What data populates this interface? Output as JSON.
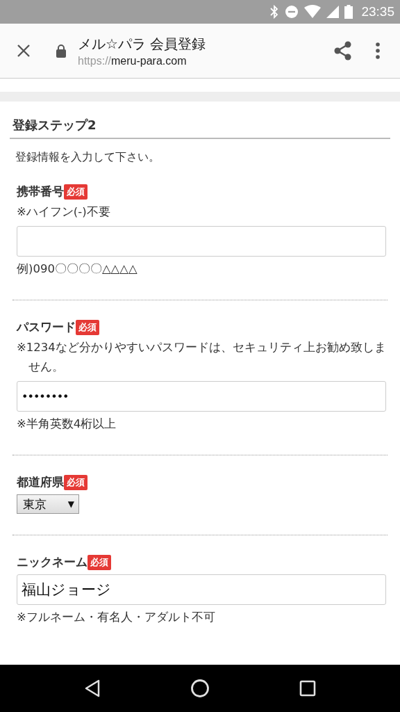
{
  "status_bar": {
    "time": "23:35"
  },
  "toolbar": {
    "title": "メル☆パラ 会員登録",
    "url_scheme": "https://",
    "url_host": "meru-para.com"
  },
  "heading": "登録ステップ2",
  "intro": "登録情報を入力して下さい。",
  "sections": [
    {
      "kind": "text",
      "label": "携帯番号",
      "badge": "必須",
      "notes_above": [
        "※ハイフン(-)不要"
      ],
      "notes_below": [
        "例)090〇〇〇〇△△△△"
      ]
    },
    {
      "kind": "password",
      "label": "パスワード",
      "badge": "必須",
      "notes_above": [
        "※1234など分かりやすいパスワードは、セキュリティ上お勧め致しません。"
      ],
      "value": "••••••••",
      "notes_below": [
        "※半角英数4桁以上"
      ]
    },
    {
      "kind": "select",
      "label": "都道府県",
      "badge": "必須",
      "value": "東京",
      "caret": "▼"
    },
    {
      "kind": "text",
      "label": "ニックネーム",
      "badge": "必須",
      "value": "福山ジョージ",
      "notes_below": [
        "※フルネーム・有名人・アダルト不可"
      ]
    }
  ]
}
